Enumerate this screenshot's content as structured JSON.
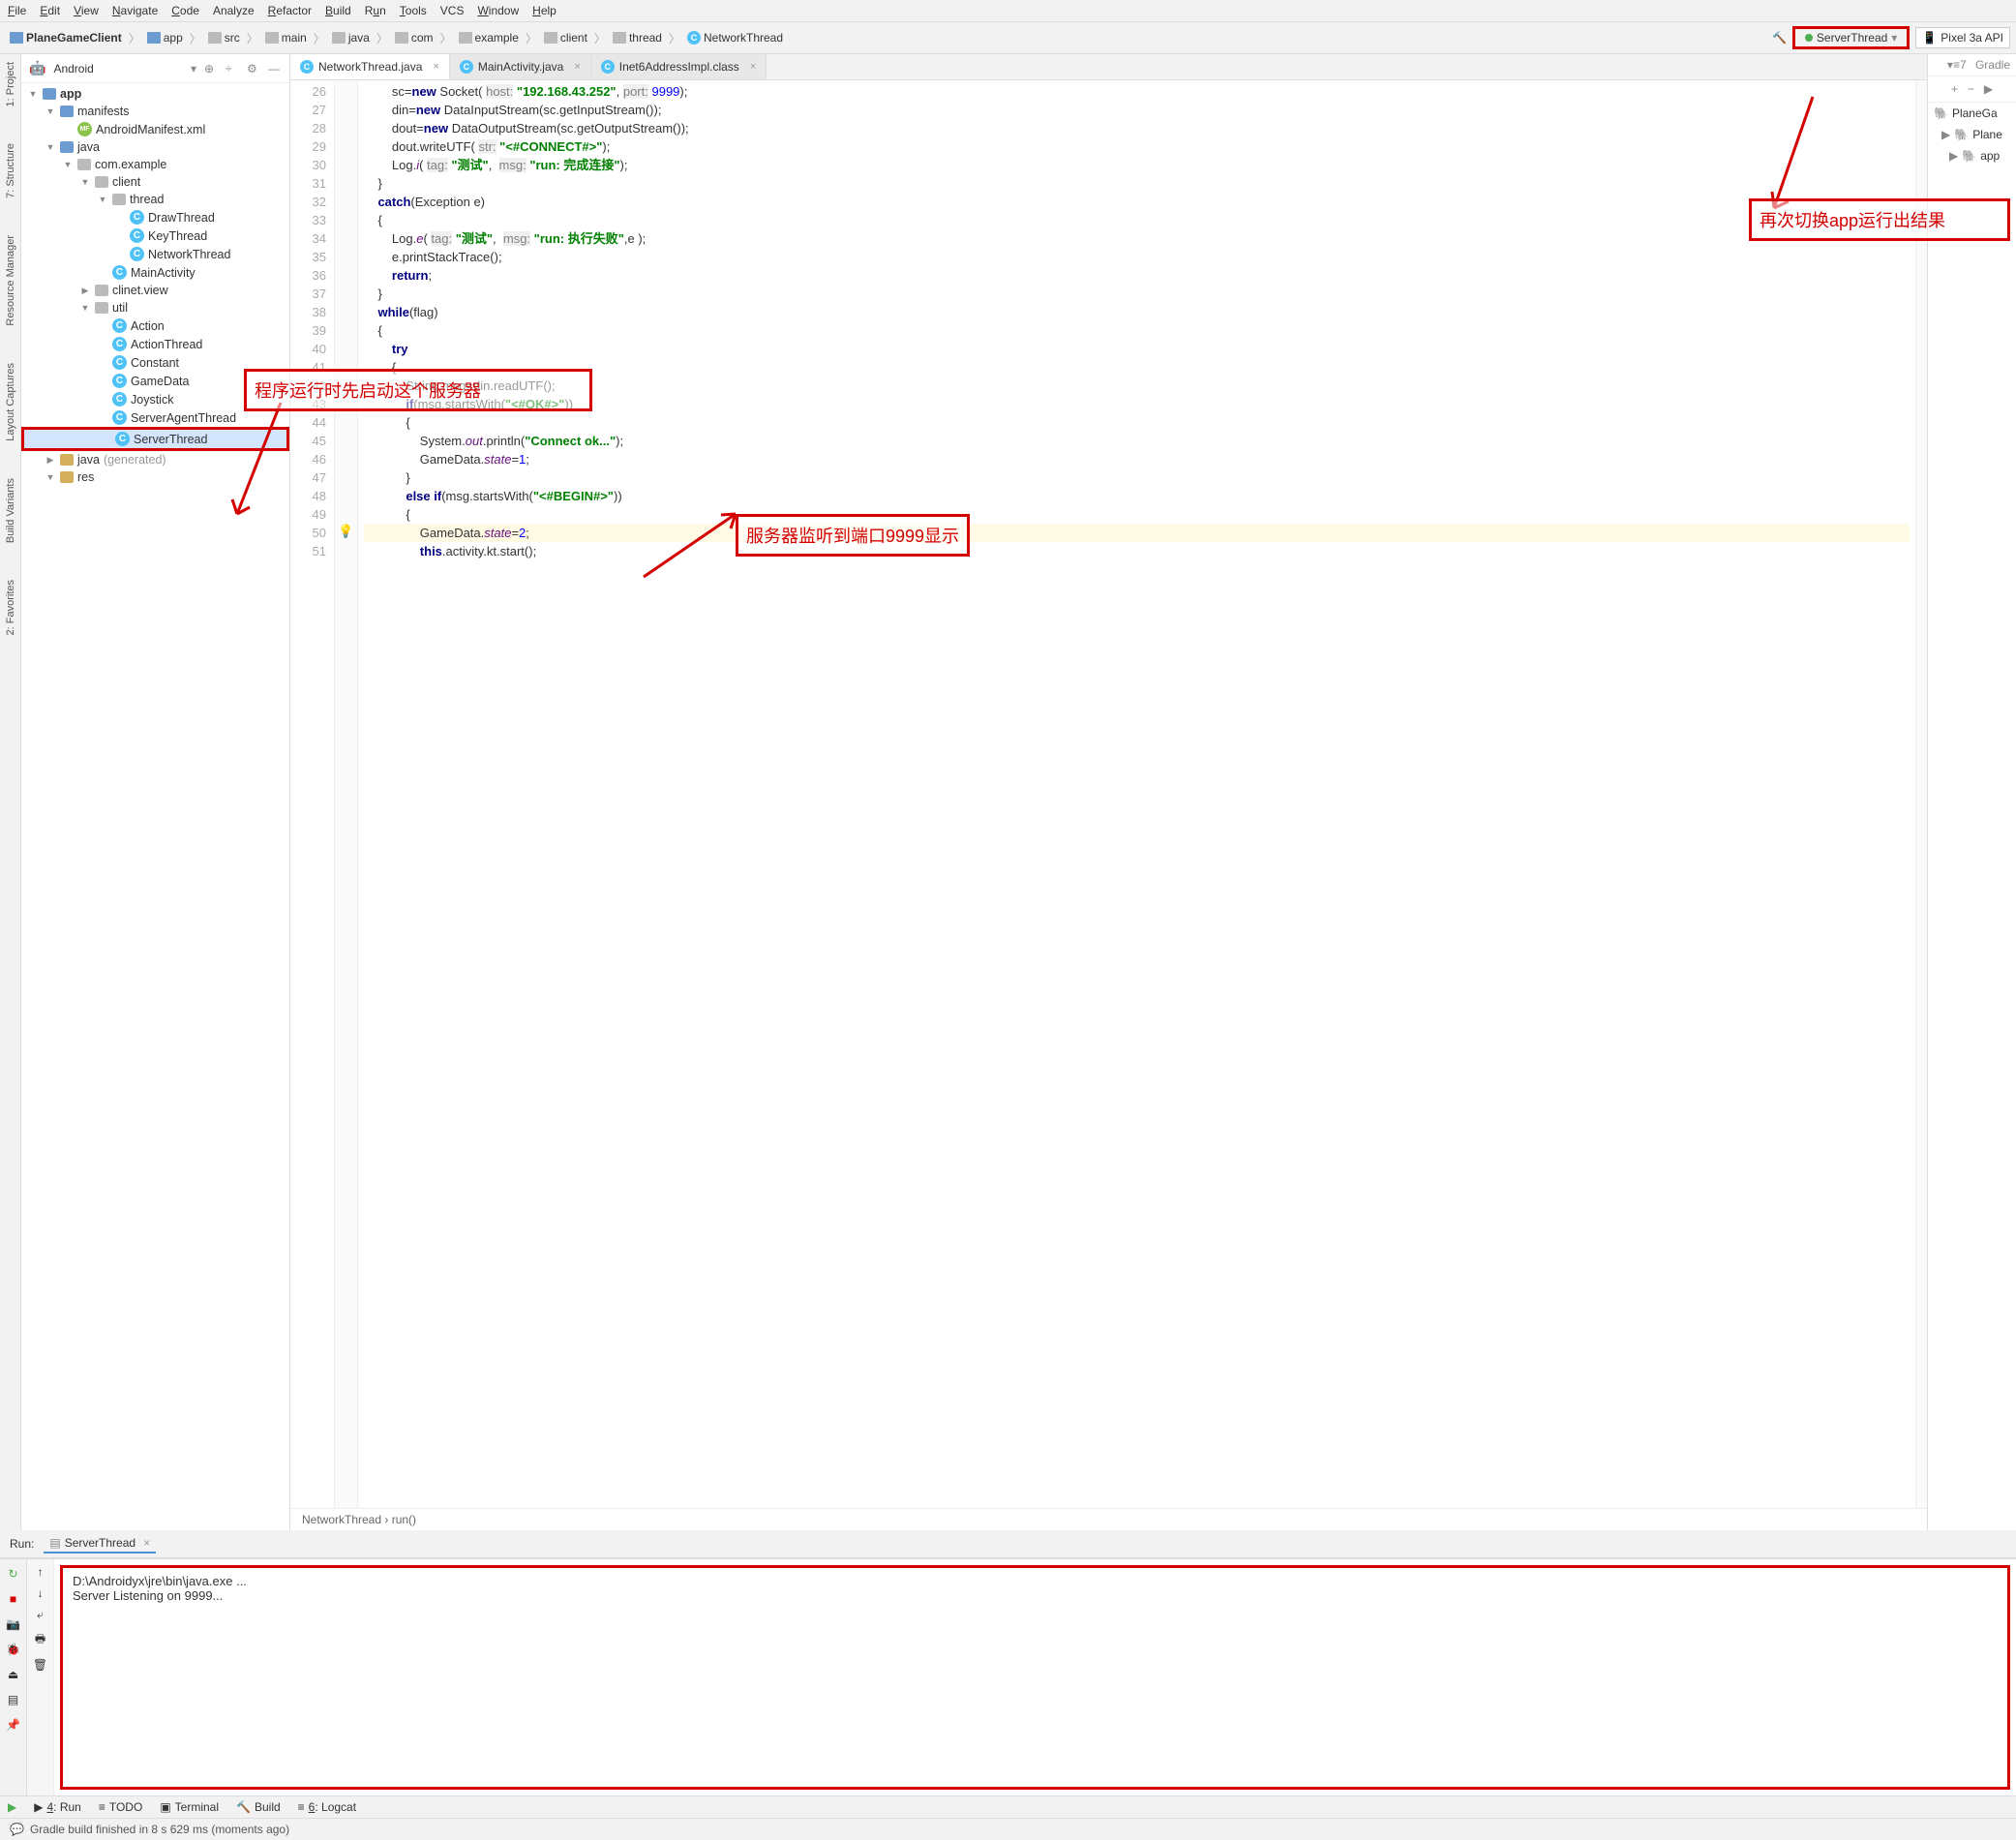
{
  "menu": [
    "File",
    "Edit",
    "View",
    "Navigate",
    "Code",
    "Analyze",
    "Refactor",
    "Build",
    "Run",
    "Tools",
    "VCS",
    "Window",
    "Help"
  ],
  "menu_underline": [
    "F",
    "E",
    "V",
    "N",
    "C",
    null,
    "R",
    "B",
    "u",
    "T",
    null,
    "W",
    "H"
  ],
  "breadcrumb": [
    "PlaneGameClient",
    "app",
    "src",
    "main",
    "java",
    "com",
    "example",
    "client",
    "thread",
    "NetworkThread"
  ],
  "runConfig": "ServerThread",
  "deviceBtn": "Pixel 3a API",
  "gradleLabel": "Gradle",
  "projectPane": {
    "title": "Android"
  },
  "tree": [
    {
      "indent": 0,
      "icon": "module",
      "label": "app",
      "arrow": "▼",
      "bold": true
    },
    {
      "indent": 1,
      "icon": "folder-blue",
      "label": "manifests",
      "arrow": "▼"
    },
    {
      "indent": 2,
      "icon": "xml",
      "label": "AndroidManifest.xml",
      "arrow": ""
    },
    {
      "indent": 1,
      "icon": "folder-blue",
      "label": "java",
      "arrow": "▼"
    },
    {
      "indent": 2,
      "icon": "folder-grey",
      "label": "com.example",
      "arrow": "▼"
    },
    {
      "indent": 3,
      "icon": "folder-grey",
      "label": "client",
      "arrow": "▼"
    },
    {
      "indent": 4,
      "icon": "folder-grey",
      "label": "thread",
      "arrow": "▼"
    },
    {
      "indent": 5,
      "icon": "class",
      "label": "DrawThread",
      "arrow": ""
    },
    {
      "indent": 5,
      "icon": "class",
      "label": "KeyThread",
      "arrow": ""
    },
    {
      "indent": 5,
      "icon": "class",
      "label": "NetworkThread",
      "arrow": ""
    },
    {
      "indent": 4,
      "icon": "class",
      "label": "MainActivity",
      "arrow": ""
    },
    {
      "indent": 3,
      "icon": "folder-grey",
      "label": "clinet.view",
      "arrow": "▶"
    },
    {
      "indent": 3,
      "icon": "folder-grey",
      "label": "util",
      "arrow": "▼"
    },
    {
      "indent": 4,
      "icon": "class",
      "label": "Action",
      "arrow": ""
    },
    {
      "indent": 4,
      "icon": "class",
      "label": "ActionThread",
      "arrow": ""
    },
    {
      "indent": 4,
      "icon": "class",
      "label": "Constant",
      "arrow": ""
    },
    {
      "indent": 4,
      "icon": "class",
      "label": "GameData",
      "arrow": ""
    },
    {
      "indent": 4,
      "icon": "class",
      "label": "Joystick",
      "arrow": ""
    },
    {
      "indent": 4,
      "icon": "class",
      "label": "ServerAgentThread",
      "arrow": ""
    },
    {
      "indent": 4,
      "icon": "class",
      "label": "ServerThread",
      "arrow": "",
      "selected": true,
      "red": true
    },
    {
      "indent": 1,
      "icon": "folder",
      "label": "java",
      "suffix": " (generated)",
      "arrow": "▶"
    },
    {
      "indent": 1,
      "icon": "folder",
      "label": "res",
      "arrow": "▼"
    }
  ],
  "tabs": [
    {
      "label": "NetworkThread.java",
      "active": true
    },
    {
      "label": "MainActivity.java",
      "active": false
    },
    {
      "label": "Inet6AddressImpl.class",
      "active": false
    }
  ],
  "code_lines": [
    {
      "n": 26,
      "html": "        sc=<span class='kw'>new</span> Socket( <span class='param'>host:</span> <span class='str'>\"192.168.43.252\"</span>, <span class='param'>port:</span> <span class='num'>9999</span>);"
    },
    {
      "n": 27,
      "html": "        din=<span class='kw'>new</span> DataInputStream(sc.getInputStream());"
    },
    {
      "n": 28,
      "html": "        dout=<span class='kw'>new</span> DataOutputStream(sc.getOutputStream());"
    },
    {
      "n": 29,
      "html": "        dout.writeUTF( <span class='param'>str:</span> <span class='str'>\"&lt;#CONNECT#&gt;\"</span>);"
    },
    {
      "n": 30,
      "html": "        Log.<span class='static'>i</span>( <span class='param'>tag:</span> <span class='str'>\"测试\"</span>,  <span class='param'>msg:</span> <span class='str'>\"run: 完成连接\"</span>);"
    },
    {
      "n": 31,
      "html": "    }"
    },
    {
      "n": 32,
      "html": "    <span class='kw'>catch</span>(Exception e)"
    },
    {
      "n": 33,
      "html": "    {"
    },
    {
      "n": 34,
      "html": "        Log.<span class='static'>e</span>( <span class='param'>tag:</span> <span class='str'>\"测试\"</span>,  <span class='param'>msg:</span> <span class='str'>\"run: 执行失败\"</span>,e );"
    },
    {
      "n": 35,
      "html": "        e.printStackTrace();"
    },
    {
      "n": 36,
      "html": "        <span class='kw'>return</span>;"
    },
    {
      "n": 37,
      "html": "    }"
    },
    {
      "n": 38,
      "html": "    <span class='kw'>while</span>(flag)"
    },
    {
      "n": 39,
      "html": "    {"
    },
    {
      "n": 40,
      "html": "        <span class='kw'>try</span>"
    },
    {
      "n": 41,
      "html": "        {"
    },
    {
      "n": 42,
      "html": "            String msg=din.readUTF();"
    },
    {
      "n": 43,
      "html": "            <span class='kw'>if</span>(msg.startsWith(<span class='str'>\"&lt;#OK#&gt;\"</span>))"
    },
    {
      "n": 44,
      "html": "            {"
    },
    {
      "n": 45,
      "html": "                System.<span class='static'>out</span>.println(<span class='str'>\"Connect ok...\"</span>);"
    },
    {
      "n": 46,
      "html": "                GameData.<span class='static'>state</span>=<span class='num'>1</span>;"
    },
    {
      "n": 47,
      "html": "            }"
    },
    {
      "n": 48,
      "html": "            <span class='kw'>else if</span>(msg.startsWith(<span class='str'>\"&lt;#BEGIN#&gt;\"</span>))"
    },
    {
      "n": 49,
      "html": "            {"
    },
    {
      "n": 50,
      "html": "                GameData.<span class='static'>state</span>=<span class='num'>2</span>;",
      "hl": true,
      "bulb": true
    },
    {
      "n": 51,
      "html": "                <span class='kw'>this</span>.activity.kt.start();"
    }
  ],
  "editorBreadcrumb": "NetworkThread  ›  run()",
  "annotations": {
    "a1": "程序运行时先启动这个服务器",
    "a2": "服务器监听到端口9999显示",
    "a3": "再次切换app运行出结果"
  },
  "rightPane": {
    "items": [
      "PlaneGa",
      "Plane",
      "app"
    ]
  },
  "run": {
    "label": "Run:",
    "tab": "ServerThread",
    "output": [
      "D:\\Androidyx\\jre\\bin\\java.exe ...",
      "Server Listening on 9999..."
    ]
  },
  "bottomTabs": [
    {
      "icon": "▶",
      "label": "4: Run",
      "u": "4"
    },
    {
      "icon": "≡",
      "label": "TODO"
    },
    {
      "icon": "▣",
      "label": "Terminal"
    },
    {
      "icon": "🔨",
      "label": "Build"
    },
    {
      "icon": "≡",
      "label": "6: Logcat",
      "u": "6"
    }
  ],
  "status": "Gradle build finished in 8 s 629 ms (moments ago)",
  "leftTools": [
    "1: Project",
    "7: Structure",
    "Resource Manager",
    "Layout Captures",
    "Build Variants",
    "2: Favorites"
  ]
}
